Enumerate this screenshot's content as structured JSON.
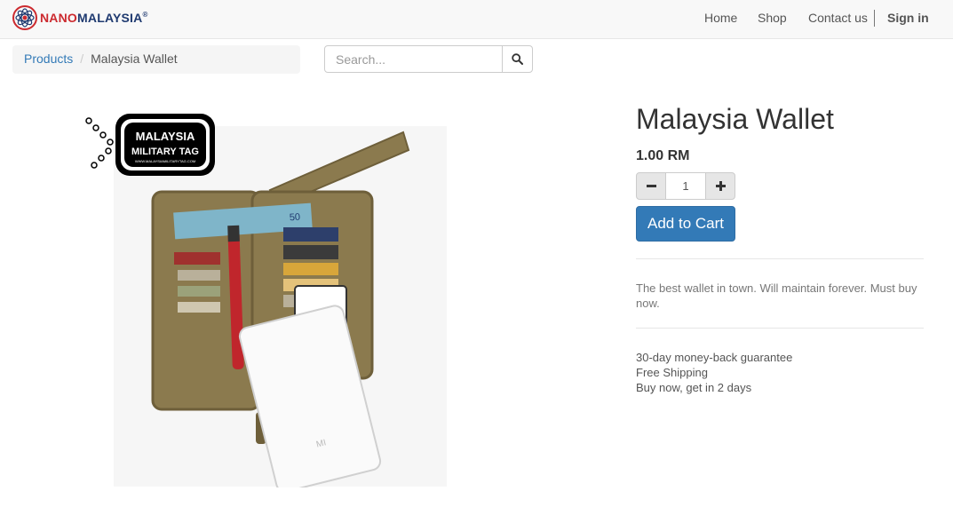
{
  "brand": {
    "name_part1": "NANO",
    "name_part2": "MALAYSIA",
    "registered": "®"
  },
  "nav": {
    "home": "Home",
    "shop": "Shop",
    "contact": "Contact us",
    "signin": "Sign in"
  },
  "breadcrumb": {
    "parent": "Products",
    "current": "Malaysia Wallet"
  },
  "search": {
    "placeholder": "Search...",
    "button_icon": "search-icon"
  },
  "product": {
    "title": "Malaysia Wallet",
    "price": "1.00 RM",
    "quantity": "1",
    "qty_minus_icon": "minus-icon",
    "qty_plus_icon": "plus-icon",
    "add_to_cart": "Add to Cart",
    "description": "The best wallet in town. Will maintain forever. Must buy now.",
    "terms": [
      "30-day money-back guarantee",
      "Free Shipping",
      "Buy now, get in 2 days"
    ],
    "image": {
      "tag_line1": "MALAYSIA",
      "tag_line2": "MILITARY TAG",
      "tag_url": "WWW.MALAYSIAMILITARYTAG.COM",
      "banknote_value": "50",
      "powerbank_logo": "MI",
      "colors": {
        "wallet": "#8b7a4e",
        "wallet_dark": "#6e5f3a",
        "pen": "#c0262c",
        "banknote": "#7fb5c9"
      }
    }
  },
  "colors": {
    "accent": "#337ab7",
    "brand_red": "#cc2a2f",
    "brand_blue": "#1f3a70"
  }
}
